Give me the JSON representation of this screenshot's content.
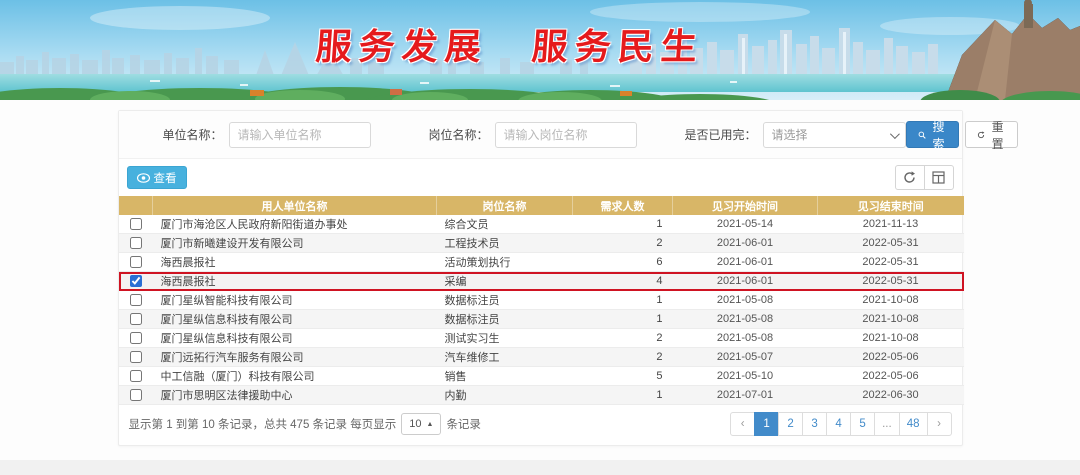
{
  "banner": {
    "slogan_left": "服务发展",
    "slogan_right": "服务民生"
  },
  "filters": {
    "unit_label": "单位名称：",
    "unit_placeholder": "请输入单位名称",
    "position_label": "岗位名称：",
    "position_placeholder": "请输入岗位名称",
    "used_label": "是否已用完：",
    "used_value": "请选择",
    "search_label": "搜索",
    "reset_label": "重置"
  },
  "toolbar": {
    "view_label": "查看"
  },
  "table": {
    "headers": [
      "用人单位名称",
      "岗位名称",
      "需求人数",
      "见习开始时间",
      "见习结束时间"
    ],
    "rows": [
      {
        "checked": false,
        "selected": false,
        "employer": "厦门市海沧区人民政府新阳街道办事处",
        "position": "综合文员",
        "count": "1",
        "start": "2021-05-14",
        "end": "2021-11-13"
      },
      {
        "checked": false,
        "selected": false,
        "employer": "厦门市新曦建设开发有限公司",
        "position": "工程技术员",
        "count": "2",
        "start": "2021-06-01",
        "end": "2022-05-31"
      },
      {
        "checked": false,
        "selected": false,
        "employer": "海西晨报社",
        "position": "活动策划执行",
        "count": "6",
        "start": "2021-06-01",
        "end": "2022-05-31"
      },
      {
        "checked": true,
        "selected": true,
        "employer": "海西晨报社",
        "position": "采编",
        "count": "4",
        "start": "2021-06-01",
        "end": "2022-05-31"
      },
      {
        "checked": false,
        "selected": false,
        "employer": "厦门星纵智能科技有限公司",
        "position": "数据标注员",
        "count": "1",
        "start": "2021-05-08",
        "end": "2021-10-08"
      },
      {
        "checked": false,
        "selected": false,
        "employer": "厦门星纵信息科技有限公司",
        "position": "数据标注员",
        "count": "1",
        "start": "2021-05-08",
        "end": "2021-10-08"
      },
      {
        "checked": false,
        "selected": false,
        "employer": "厦门星纵信息科技有限公司",
        "position": "测试实习生",
        "count": "2",
        "start": "2021-05-08",
        "end": "2021-10-08"
      },
      {
        "checked": false,
        "selected": false,
        "employer": "厦门远拓行汽车服务有限公司",
        "position": "汽车维修工",
        "count": "2",
        "start": "2021-05-07",
        "end": "2022-05-06"
      },
      {
        "checked": false,
        "selected": false,
        "employer": "中工信融（厦门）科技有限公司",
        "position": "销售",
        "count": "5",
        "start": "2021-05-10",
        "end": "2022-05-06"
      },
      {
        "checked": false,
        "selected": false,
        "employer": "厦门市思明区法律援助中心",
        "position": "内勤",
        "count": "1",
        "start": "2021-07-01",
        "end": "2022-06-30"
      }
    ]
  },
  "footer": {
    "summary_left": "显示第 1 到第 10 条记录，总共 475 条记录 每页显示",
    "page_size": "10",
    "summary_right": "条记录",
    "prev": "‹",
    "next": "›",
    "pages": [
      "1",
      "2",
      "3",
      "4",
      "5",
      "...",
      "48"
    ],
    "active_page": "1"
  },
  "icons": {
    "page_size_caret": "▲"
  },
  "colors": {
    "table_header": "#d8b667",
    "primary_blue": "#3a87c8",
    "view_blue": "#47b1de",
    "pagination_active": "#428bca",
    "selected_row_border": "#cf1322",
    "slogan_red": "#e51a1c"
  }
}
